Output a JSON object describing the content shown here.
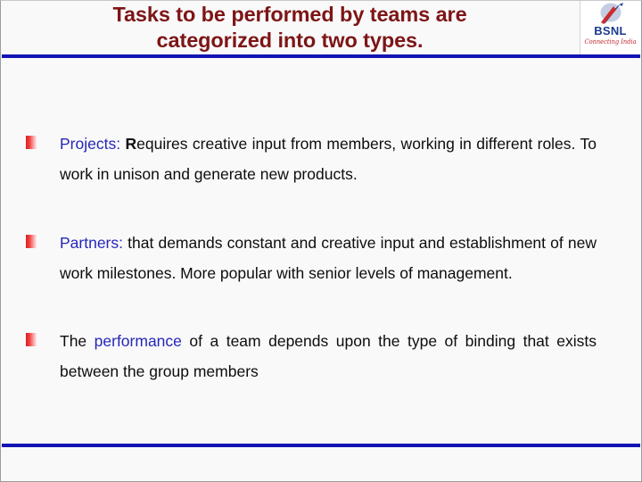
{
  "slide": {
    "title_line1": "Tasks to be performed by teams are",
    "title_line2": "categorized into two types.",
    "title_color": "#7d1515",
    "rule_color": "#1414b4",
    "background_color": "#f9f9fa",
    "keyword_color": "#2626b8",
    "bullet_color": "#e01c1c"
  },
  "logo": {
    "name": "BSNL",
    "tagline": "Connecting India",
    "text_color": "#1b3a8f",
    "tagline_color": "#c1272d"
  },
  "bullets": [
    {
      "keyword": "Projects:",
      "lead": "R",
      "rest": "equires creative input from members, working in different roles. To work in unison and generate new products."
    },
    {
      "keyword": "Partners:",
      "rest": " that demands constant and creative input and establishment of new work milestones. More popular with senior levels of management."
    },
    {
      "prefix": "The ",
      "keyword": "performance",
      "rest": "  of a team depends upon the type of binding that exists between the group members"
    }
  ]
}
